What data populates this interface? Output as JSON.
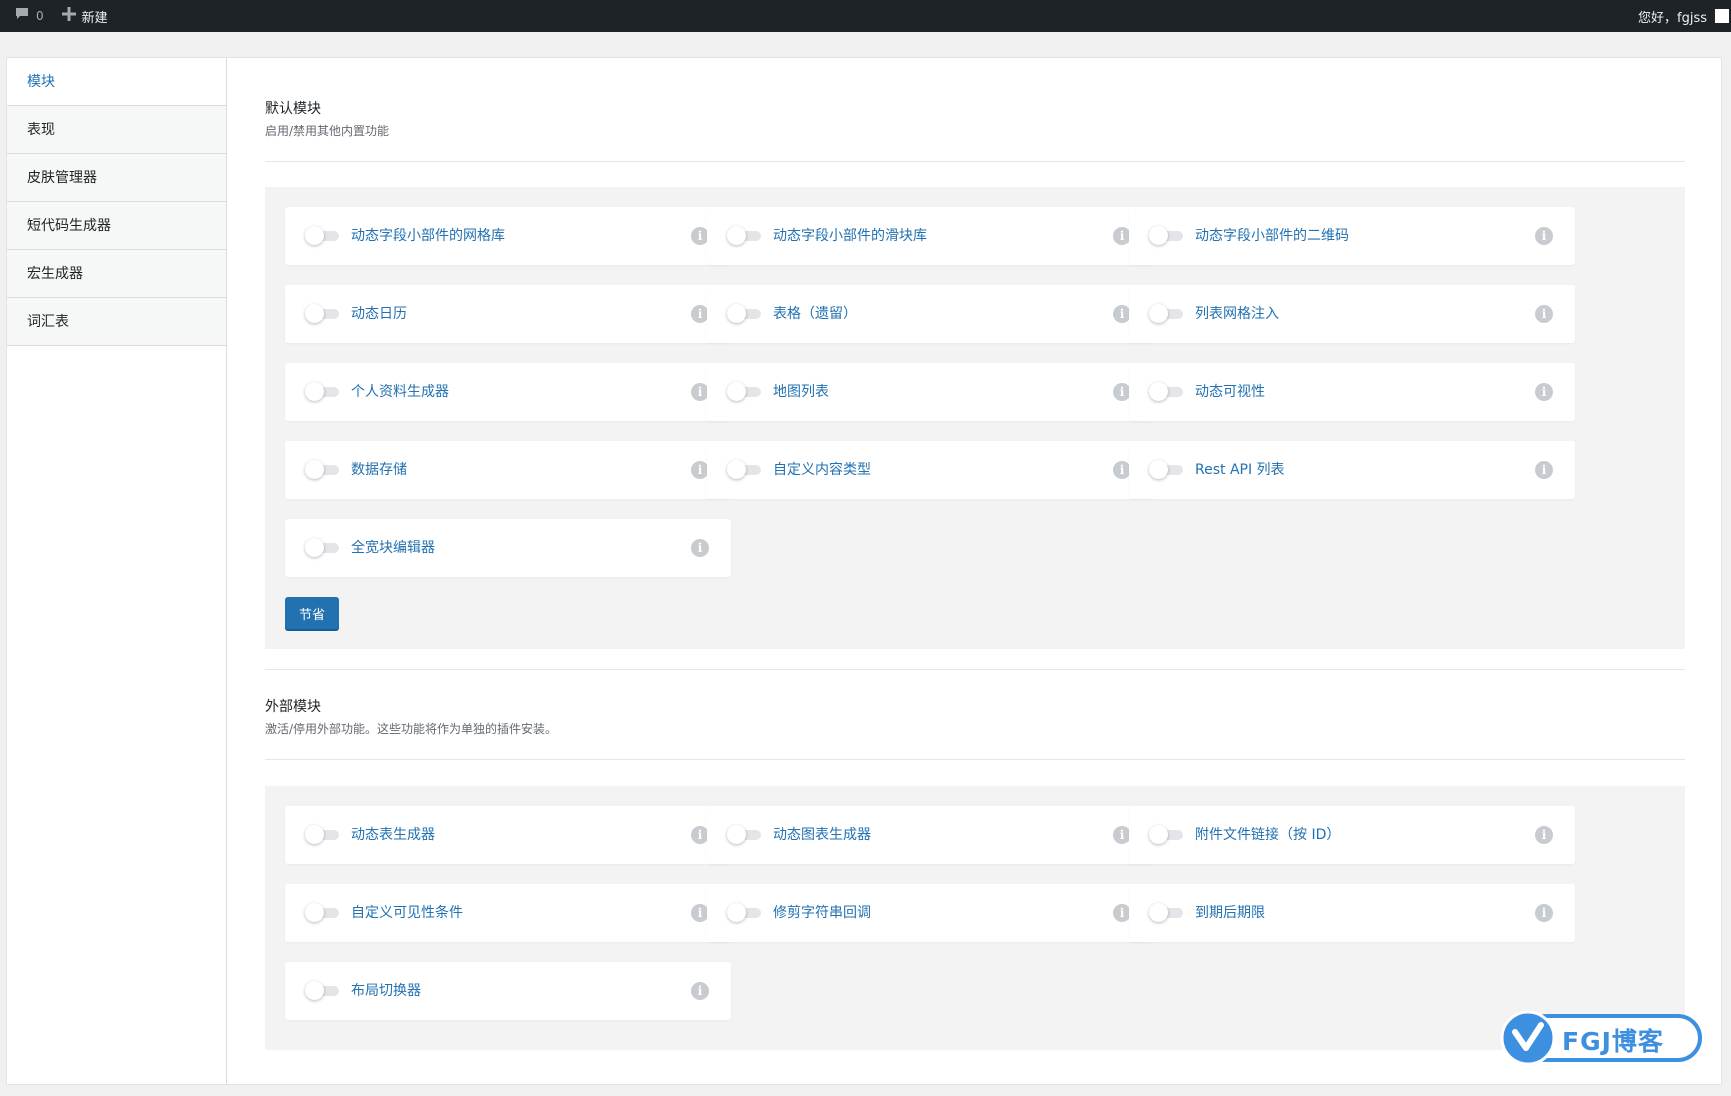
{
  "adminbar": {
    "comments_count": "0",
    "new_label": "新建",
    "greeting": "您好，fgjss"
  },
  "sidebar": {
    "items": [
      {
        "label": "模块",
        "active": true
      },
      {
        "label": "表现"
      },
      {
        "label": "皮肤管理器"
      },
      {
        "label": "短代码生成器"
      },
      {
        "label": "宏生成器"
      },
      {
        "label": "词汇表"
      }
    ]
  },
  "default_section": {
    "title": "默认模块",
    "description": "启用/禁用其他内置功能",
    "modules": [
      "动态字段小部件的网格库",
      "动态字段小部件的滑块库",
      "动态字段小部件的二维码",
      "动态日历",
      "表格（遗留）",
      "列表网格注入",
      "个人资料生成器",
      "地图列表",
      "动态可视性",
      "数据存储",
      "自定义内容类型",
      "Rest API 列表",
      "全宽块编辑器"
    ],
    "save_label": "节省"
  },
  "external_section": {
    "title": "外部模块",
    "description": "激活/停用外部功能。这些功能将作为单独的插件安装。",
    "modules": [
      "动态表生成器",
      "动态图表生成器",
      "附件文件链接（按 ID）",
      "自定义可见性条件",
      "修剪字符串回调",
      "到期后期限",
      "布局切换器"
    ]
  },
  "watermark": {
    "text": "FGJ博客"
  },
  "colors": {
    "accent": "#2271b1",
    "adminbar": "#1d2327",
    "toggle_off": "#e3e5e8"
  },
  "icons": [
    "comment-icon",
    "plus-icon",
    "info-icon",
    "toggle-switch",
    "fgj-logo-icon"
  ]
}
